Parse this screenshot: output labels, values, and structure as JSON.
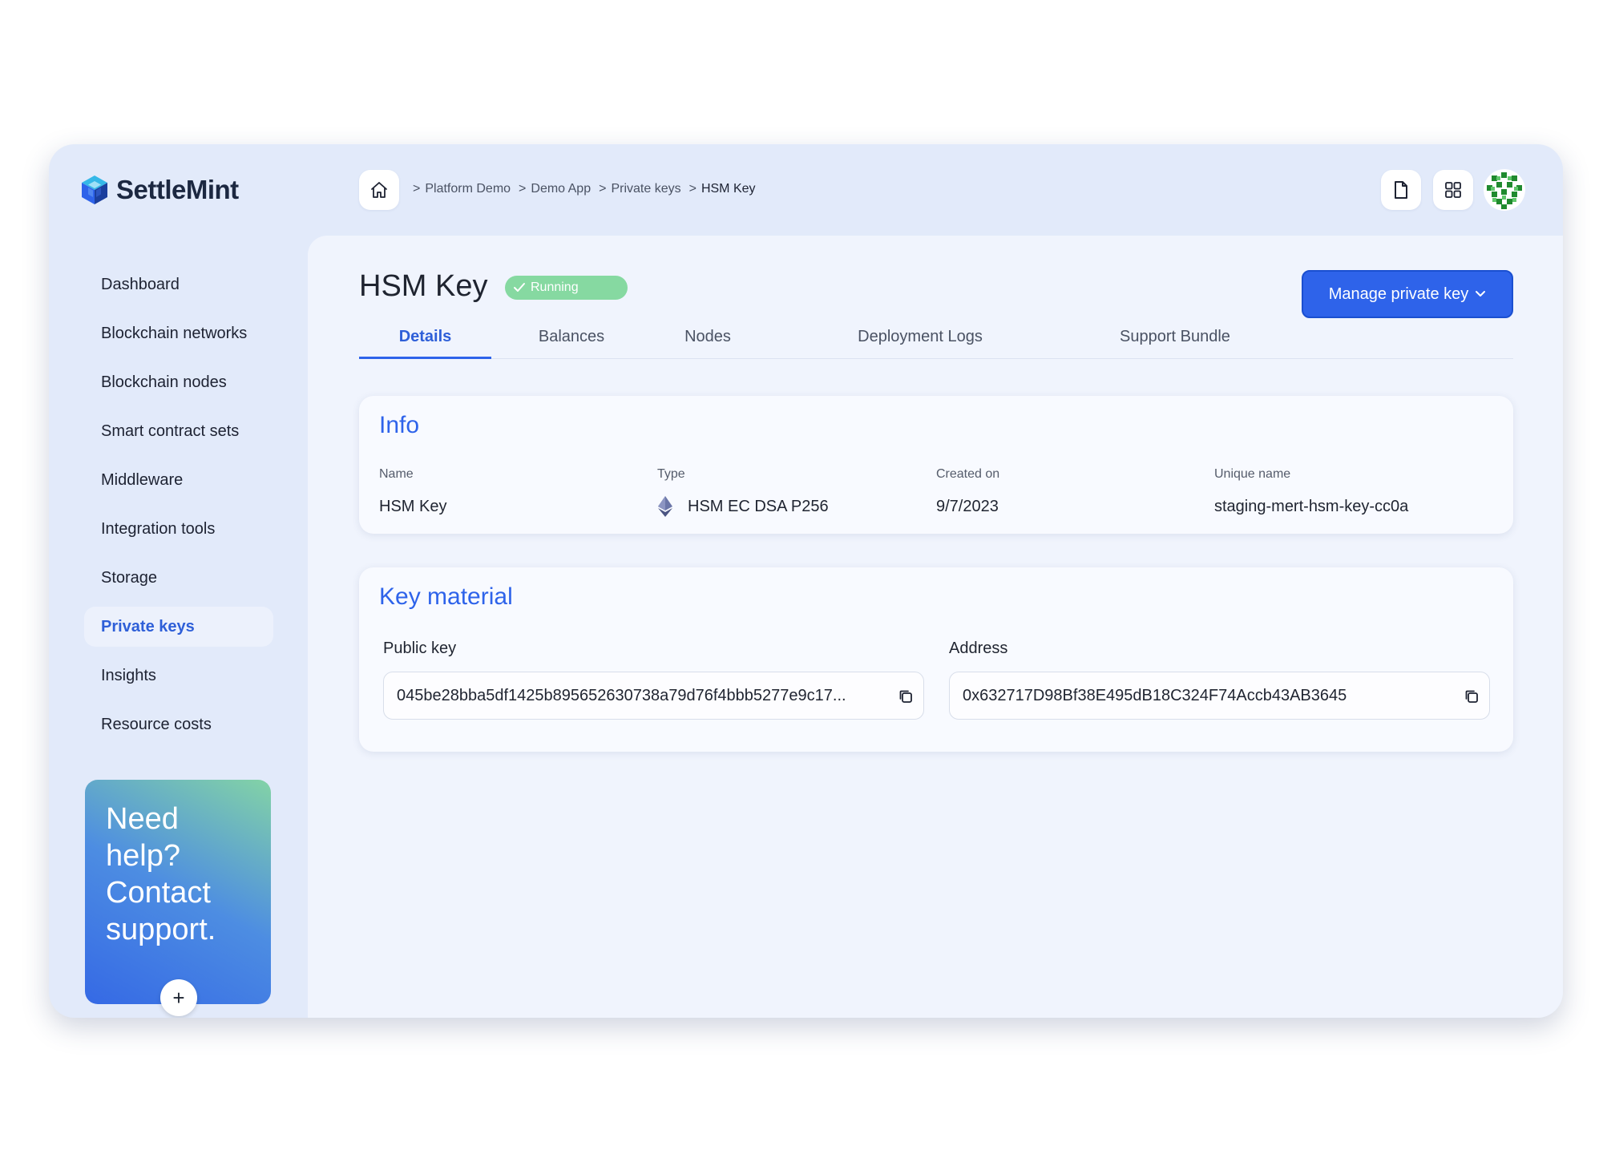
{
  "brand": {
    "name": "SettleMint",
    "accent": "#2e63ea",
    "logo_icon": "cube-logo-icon"
  },
  "sidebar": {
    "items": [
      {
        "label": "Dashboard",
        "active": false
      },
      {
        "label": "Blockchain networks",
        "active": false
      },
      {
        "label": "Blockchain nodes",
        "active": false
      },
      {
        "label": "Smart contract sets",
        "active": false
      },
      {
        "label": "Middleware",
        "active": false
      },
      {
        "label": "Integration tools",
        "active": false
      },
      {
        "label": "Storage",
        "active": false
      },
      {
        "label": "Private keys",
        "active": true
      },
      {
        "label": "Insights",
        "active": false
      },
      {
        "label": "Resource costs",
        "active": false
      }
    ],
    "help_card": {
      "text": "Need\nhelp?\nContact\nsupport.",
      "button_icon": "plus-icon"
    }
  },
  "topbar": {
    "home_icon": "home-icon",
    "breadcrumb": [
      {
        "label": "Platform Demo"
      },
      {
        "label": "Demo App"
      },
      {
        "label": "Private keys"
      },
      {
        "label": "HSM Key"
      }
    ],
    "separator": ">",
    "icons": [
      "document-icon",
      "grid-icon",
      "avatar"
    ]
  },
  "page": {
    "title": "HSM Key",
    "status": {
      "label": "Running",
      "color": "#86d9a1"
    },
    "manage_button": {
      "label": "Manage private key"
    },
    "tabs": [
      {
        "label": "Details",
        "active": true
      },
      {
        "label": "Balances",
        "active": false
      },
      {
        "label": "Nodes",
        "active": false
      },
      {
        "label": "Deployment Logs",
        "active": false
      },
      {
        "label": "Support Bundle",
        "active": false
      }
    ]
  },
  "info": {
    "title": "Info",
    "fields": [
      {
        "label": "Name",
        "value": "HSM Key"
      },
      {
        "label": "Type",
        "value": "HSM EC DSA P256",
        "icon": "ethereum-icon"
      },
      {
        "label": "Created on",
        "value": "9/7/2023"
      },
      {
        "label": "Unique name",
        "value": "staging-mert-hsm-key-cc0a"
      }
    ]
  },
  "key_material": {
    "title": "Key material",
    "public_key": {
      "label": "Public key",
      "value": "045be28bba5df1425b895652630738a79d76f4bbb5277e9c17..."
    },
    "address": {
      "label": "Address",
      "value": "0x632717D98Bf38E495dB18C324F74Accb43AB3645"
    }
  }
}
